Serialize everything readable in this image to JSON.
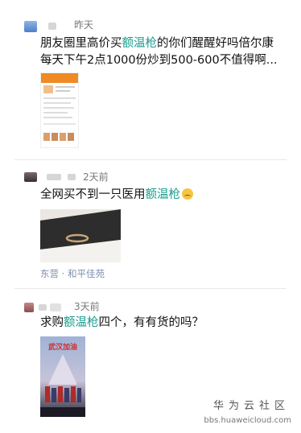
{
  "posts": [
    {
      "time": "昨天",
      "text_before": "朋友圈里高价买",
      "keyword": "额温枪",
      "text_after": "的你们醒醒好吗倍尔康",
      "line2": "每天下午2点1000份炒到500-600不值得啊..."
    },
    {
      "time": "2天前",
      "text_before": "全网买不到一只医用",
      "keyword": "额温枪",
      "text_after": "",
      "emoji": "sad-face",
      "location": "东营 · 和平佳苑"
    },
    {
      "time": "3天前",
      "text_before": "求购",
      "keyword": "额温枪",
      "text_after": "四个，有有货的吗？",
      "poster_title": "武汉加油"
    }
  ],
  "watermark": {
    "name": "华为云社区",
    "url": "bbs.huaweicloud.com"
  },
  "colors": {
    "keyword": "#1a9c8f",
    "location": "#7c8fb0"
  }
}
